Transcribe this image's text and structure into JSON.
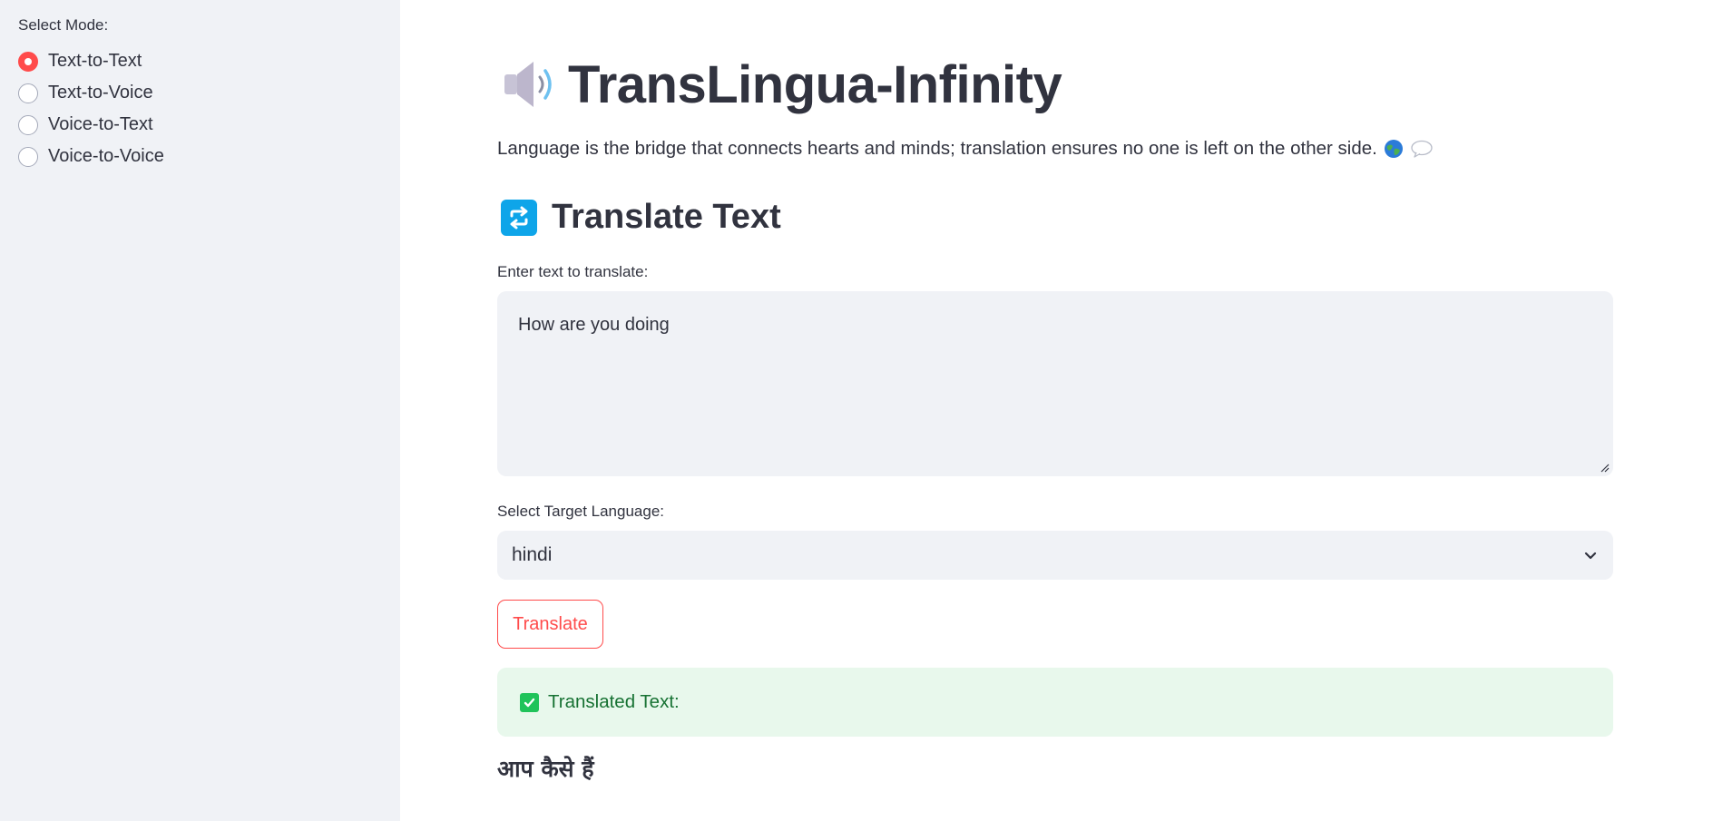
{
  "sidebar": {
    "label": "Select Mode:",
    "options": [
      {
        "label": "Text-to-Text",
        "selected": true
      },
      {
        "label": "Text-to-Voice",
        "selected": false
      },
      {
        "label": "Voice-to-Text",
        "selected": false
      },
      {
        "label": "Voice-to-Voice",
        "selected": false
      }
    ]
  },
  "header": {
    "title": "TransLingua-Infinity",
    "title_icon": "speaker-icon",
    "tagline": "Language is the bridge that connects hearts and minds; translation ensures no one is left on the other side.",
    "tagline_icons": [
      "globe-icon",
      "speech-bubble-icon"
    ]
  },
  "section": {
    "title": "Translate Text",
    "icon": "repeat-icon"
  },
  "form": {
    "input_label": "Enter text to translate:",
    "input_value": "How are you doing",
    "language_label": "Select Target Language:",
    "language_value": "hindi",
    "translate_button": "Translate"
  },
  "result": {
    "status_label": "Translated Text:",
    "translated_text": "आप कैसे हैं"
  },
  "colors": {
    "accent": "#ff4b4b",
    "sidebar_bg": "#f0f2f6",
    "success_bg": "#e8f8ec",
    "success_text": "#177233"
  }
}
